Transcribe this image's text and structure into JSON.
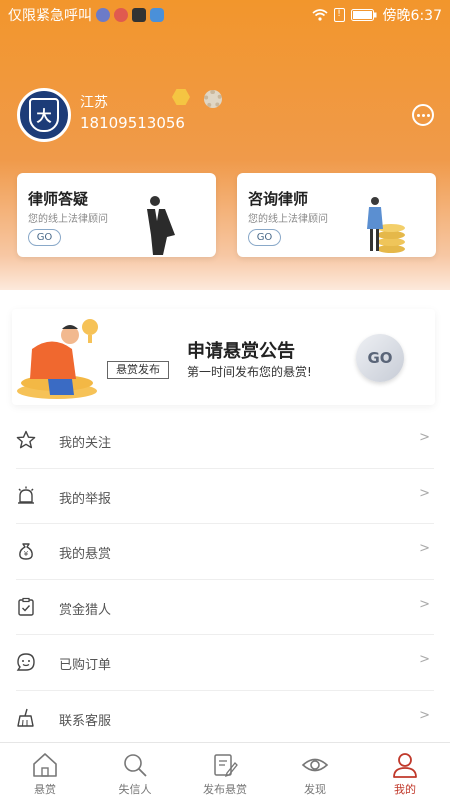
{
  "status_bar": {
    "left_text": "仅限紧急呼叫",
    "right_text": "傍晚6:37",
    "battery_mark": "!"
  },
  "profile": {
    "name": "江苏",
    "phone": "18109513056",
    "avatar_glyph": "大"
  },
  "service_cards": [
    {
      "title": "律师答疑",
      "subtitle": "您的线上法律顾问",
      "go_label": "GO"
    },
    {
      "title": "咨询律师",
      "subtitle": "您的线上法律顾问",
      "go_label": "GO"
    }
  ],
  "banner": {
    "chip_label": "悬赏发布",
    "title": "申请悬赏公告",
    "subtitle": "第一时间发布您的悬赏!",
    "go_label": "GO"
  },
  "menu": {
    "items": [
      {
        "label": "我的关注",
        "icon": "star-icon"
      },
      {
        "label": "我的举报",
        "icon": "alarm-icon"
      },
      {
        "label": "我的悬赏",
        "icon": "money-bag-icon"
      },
      {
        "label": "赏金猎人",
        "icon": "clipboard-check-icon"
      },
      {
        "label": "已购订单",
        "icon": "chat-face-icon"
      },
      {
        "label": "联系客服",
        "icon": "broom-icon"
      }
    ],
    "arrow": ">"
  },
  "tabbar": {
    "tabs": [
      {
        "label": "悬赏",
        "icon": "home-icon"
      },
      {
        "label": "失信人",
        "icon": "search-icon"
      },
      {
        "label": "发布悬赏",
        "icon": "edit-icon"
      },
      {
        "label": "发现",
        "icon": "eye-icon"
      },
      {
        "label": "我的",
        "icon": "user-icon"
      }
    ],
    "active_index": 4
  },
  "colors": {
    "header_orange": "#f2962c",
    "active_tab": "#c0392b"
  }
}
